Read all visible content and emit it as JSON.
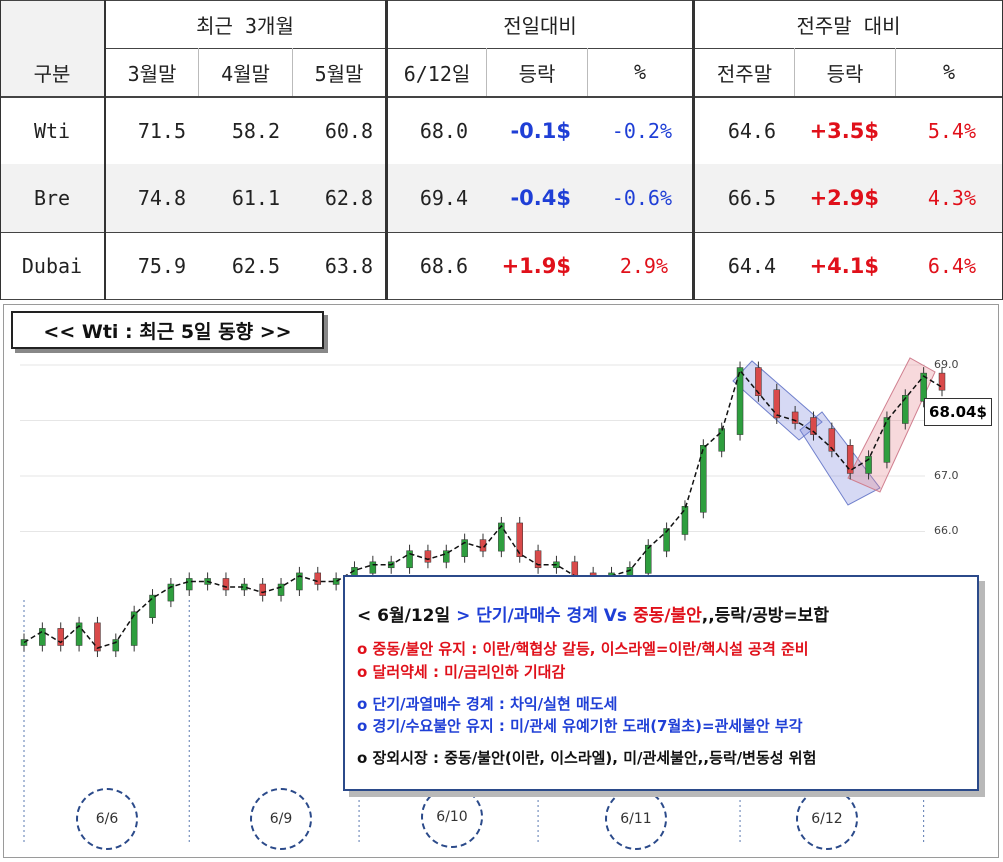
{
  "table": {
    "header_groups": [
      "최근 3개월",
      "전일대비",
      "전주말 대비"
    ],
    "columns": [
      "구분",
      "3월말",
      "4월말",
      "5월말",
      "6/12일",
      "등락",
      "%",
      "전주말",
      "등락",
      "%"
    ],
    "rows": [
      {
        "name": "Wti",
        "m3": "71.5",
        "m4": "58.2",
        "m5": "60.8",
        "d612": "68.0",
        "chg": "-0.1$",
        "pct": "-0.2%",
        "wk": "64.6",
        "wchg": "+3.5$",
        "wpct": "5.4%"
      },
      {
        "name": "Bre",
        "m3": "74.8",
        "m4": "61.1",
        "m5": "62.8",
        "d612": "69.4",
        "chg": "-0.4$",
        "pct": "-0.6%",
        "wk": "66.5",
        "wchg": "+2.9$",
        "wpct": "4.3%"
      },
      {
        "name": "Dubai",
        "m3": "75.9",
        "m4": "62.5",
        "m5": "63.8",
        "d612": "68.6",
        "chg": "+1.9$",
        "pct": "2.9%",
        "wk": "64.4",
        "wchg": "+4.1$",
        "wpct": "6.4%"
      }
    ],
    "colors": {
      "up": "#e0101a",
      "down": "#1f3fd6"
    }
  },
  "chart_title": "<< Wti : 최근 5일 동향 >>",
  "chart_data": {
    "type": "line",
    "title": "<< Wti : 최근 5일 동향 >>",
    "x": [
      "6/6",
      "6/9",
      "6/10",
      "6/11",
      "6/12"
    ],
    "y_ticks": [
      "69.0",
      "68.0",
      "67.0",
      "66.0"
    ],
    "last_price_label": "68.04$",
    "series": [
      {
        "values": [
          64.0,
          64.2,
          64.0,
          64.3,
          63.9,
          64.0,
          64.5,
          64.8,
          65.0,
          65.1,
          65.1,
          65.0,
          65.0,
          64.9,
          65.0,
          65.2,
          65.1,
          65.1,
          65.3,
          65.4,
          65.4,
          65.6,
          65.5,
          65.6,
          65.8,
          65.7,
          66.1,
          65.6,
          65.4,
          65.4,
          65.2,
          65.1,
          65.2,
          65.3,
          65.7,
          66.0,
          66.4,
          67.5,
          67.8,
          68.9,
          68.5,
          68.1,
          68.0,
          67.8,
          67.5,
          67.1,
          67.3,
          68.0,
          68.4,
          68.8,
          68.6
        ]
      }
    ]
  },
  "date_badges": [
    "6/6",
    "6/9",
    "6/10",
    "6/11",
    "6/12"
  ],
  "commentary": {
    "headline_date": "< 6월/12일",
    "headline_arrow": ">",
    "headline_a": "단기/과매수 경계 Vs",
    "headline_b": "중동/불안",
    "headline_c": ",,등락/공방=보합",
    "line1": "o 중동/불안 유지 : 이란/핵협상 갈등, 이스라엘=이란/핵시설 공격 준비",
    "line2": "o 달러약세 : 미/금리인하 기대감",
    "line3": "o 단기/과열매수 경계 : 차익/실현 매도세",
    "line4": "o 경기/수요불안 유지 : 미/관세 유예기한 도래(7월초)=관세불안 부각",
    "line5": "o 장외시장 : 중동/불안(이란, 이스라엘), 미/관세불안,,등락/변동성 위험"
  }
}
